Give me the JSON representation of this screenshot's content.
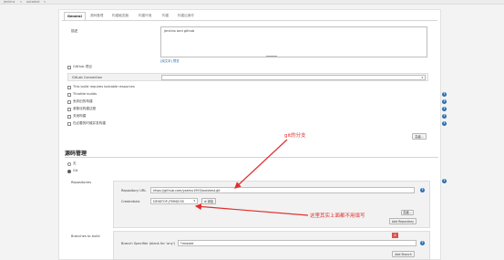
{
  "breadcrumb": {
    "item1": "jenkins",
    "sep": "»",
    "item2": "autotest",
    "sep2": "»"
  },
  "tabs": [
    "General",
    "源码管理",
    "构建触发器",
    "构建环境",
    "构建",
    "构建后操作"
  ],
  "general": {
    "desc_label": "描述",
    "desc_value": "jenkins and github",
    "plain_preview": "[纯文本] 预览",
    "github_project": "GitHub 项目",
    "gitlab_label": "GitLab Connection",
    "options": [
      "This build requires lockable resources",
      "Throttle builds",
      "丢弃旧的构建",
      "参数化构建过程",
      "关闭构建",
      "在必要的时候并发构建"
    ],
    "advanced_btn": "高级..."
  },
  "scm": {
    "title": "源码管理",
    "none": "无",
    "git": "Git",
    "repositories_label": "Repositories",
    "repo_url_label": "Repository URL",
    "repo_url_value": "https://github.com/yaemu1993/autotest.git",
    "credentials_label": "Credentials",
    "credentials_value": "DESKTOP-JTMMJO3S",
    "add_btn": "⊕ 添加",
    "advanced_btn": "高级...",
    "add_repo_btn": "Add Repository",
    "branches_label": "Branches to build",
    "branch_spec_label": "Branch Specifier (blank for 'any')",
    "branch_spec_value": "*/master",
    "add_branch_btn": "Add Branch",
    "remove": "X"
  },
  "annotations": {
    "git_branch": "git的分支",
    "note": "这里其实上面都不用填写"
  },
  "colors": {
    "accent": "#2a6fb5",
    "annotation": "#e03030"
  }
}
